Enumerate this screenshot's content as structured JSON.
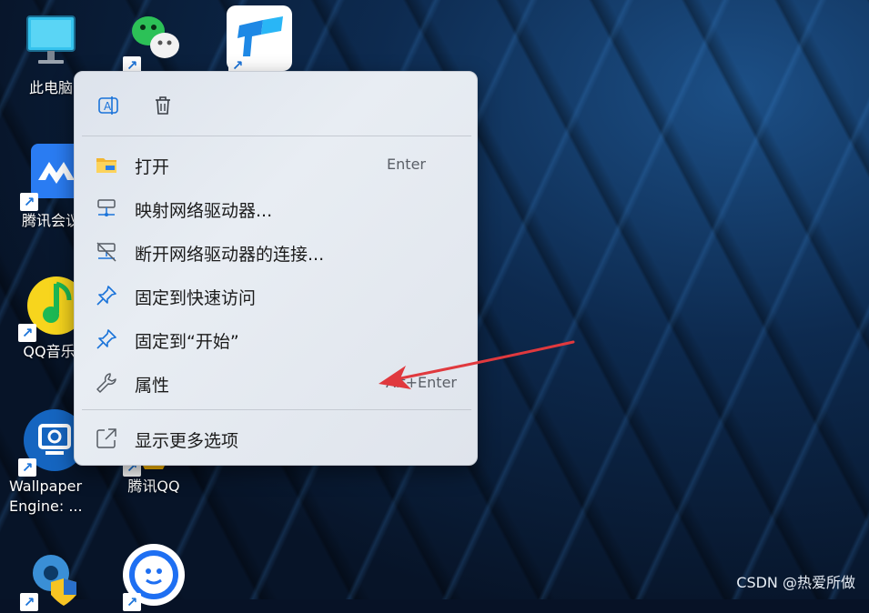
{
  "desktop_icons": [
    {
      "label": "此电脑"
    },
    {
      "label": "腾讯会议"
    },
    {
      "label": "QQ音乐"
    },
    {
      "label": "Wallpaper Engine: ..."
    },
    {
      "label": "腾讯QQ"
    }
  ],
  "context_menu": {
    "top_actions": [
      {
        "name": "rename",
        "icon": "rename-icon"
      },
      {
        "name": "delete",
        "icon": "trash-icon"
      }
    ],
    "items": [
      {
        "label": "打开",
        "shortcut": "Enter",
        "icon": "folder-icon"
      },
      {
        "label": "映射网络驱动器...",
        "icon": "network-drive-icon"
      },
      {
        "label": "断开网络驱动器的连接...",
        "icon": "disconnect-drive-icon"
      },
      {
        "label": "固定到快速访问",
        "icon": "pin-icon"
      },
      {
        "label": "固定到“开始”",
        "icon": "pin-icon"
      },
      {
        "label": "属性",
        "shortcut": "Alt+Enter",
        "icon": "wrench-icon"
      },
      {
        "label": "显示更多选项",
        "icon": "more-options-icon"
      }
    ]
  },
  "watermark": "CSDN @热爱所做",
  "colors": {
    "accent": "#1a73d9",
    "arrow": "#e0393e"
  }
}
